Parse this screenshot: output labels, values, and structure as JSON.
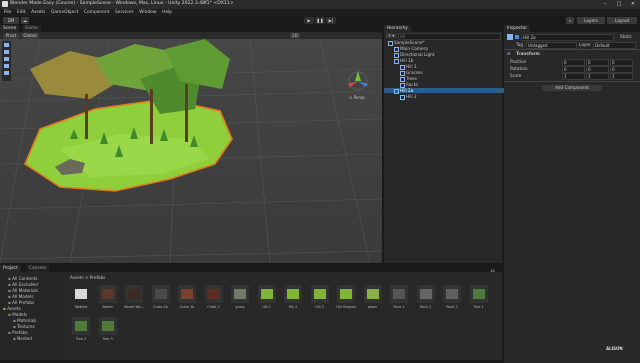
{
  "window": {
    "title": "Blender Made Easy (Course) - SampleScene - Windows, Mac, Linux - Unity 2022.3.48f1* <DX11>",
    "minimize": "–",
    "maximize": "□",
    "close": "✕"
  },
  "menu": [
    "File",
    "Edit",
    "Assets",
    "GameObject",
    "Component",
    "Services",
    "Window",
    "Help"
  ],
  "toolbar": {
    "account": "DM",
    "cloud": "☁",
    "play": "▶",
    "pause": "❚❚",
    "step": "▶|",
    "search": "⌕",
    "layers": "Layers",
    "layout": "Layout"
  },
  "scene": {
    "tab_scene": "Scene",
    "tab_game": "Game",
    "pivot": "Pivot",
    "global": "Global",
    "mode_2d": "2D",
    "persp": "< Persp"
  },
  "hierarchy": {
    "tab": "Hierarchy",
    "add": "+ ▾",
    "search_placeholder": "All",
    "items": [
      {
        "label": "SampleScene*",
        "indent": 0
      },
      {
        "label": "Main Camera",
        "indent": 1
      },
      {
        "label": "Directional Light",
        "indent": 1
      },
      {
        "label": "Hill 1b",
        "indent": 1
      },
      {
        "label": "Hill 1",
        "indent": 2
      },
      {
        "label": "Grasses",
        "indent": 2
      },
      {
        "label": "Trees",
        "indent": 2
      },
      {
        "label": "Rocks",
        "indent": 2
      },
      {
        "label": "Hill 2a",
        "indent": 1,
        "selected": true
      },
      {
        "label": "Hill 2",
        "indent": 2
      }
    ]
  },
  "inspector": {
    "tab": "Inspector",
    "object_name": "Hill 2a",
    "static": "Static",
    "tag_label": "Tag",
    "tag_value": "Untagged",
    "layer_label": "Layer",
    "layer_value": "Default",
    "component": "Transform",
    "position": {
      "label": "Position",
      "x": "0",
      "y": "0",
      "z": "0"
    },
    "rotation": {
      "label": "Rotation",
      "x": "0",
      "y": "0",
      "z": "0"
    },
    "scale": {
      "label": "Scale",
      "x": "1",
      "y": "1",
      "z": "1"
    },
    "add_component": "Add Component"
  },
  "project": {
    "tab_project": "Project",
    "tab_console": "Console",
    "tree": [
      {
        "label": "All Contents",
        "indent": 1
      },
      {
        "label": "All Excluded",
        "indent": 1
      },
      {
        "label": "All Materials",
        "indent": 1
      },
      {
        "label": "All Models",
        "indent": 1
      },
      {
        "label": "All Prefabs",
        "indent": 1
      },
      {
        "label": "Assets",
        "indent": 0
      },
      {
        "label": "Models",
        "indent": 1
      },
      {
        "label": "Materials",
        "indent": 2
      },
      {
        "label": "Textures",
        "indent": 2
      },
      {
        "label": "Prefabs",
        "indent": 1
      },
      {
        "label": "Nested",
        "indent": 2
      }
    ],
    "breadcrumb": "Assets > Prefabs",
    "count": "16",
    "assets": [
      "Nested",
      "Barrel",
      "Barrel Wo...",
      "Crate 1b",
      "Crate 1b",
      "Crate 2",
      "grass",
      "Hill 1",
      "Hill 2",
      "Hill 3",
      "Hill Shaped",
      "plank",
      "Rock 1",
      "Rock 2",
      "Rock 3",
      "Tree 1",
      "Tree 2",
      "Tree 3"
    ]
  },
  "watermark": "ALISON"
}
